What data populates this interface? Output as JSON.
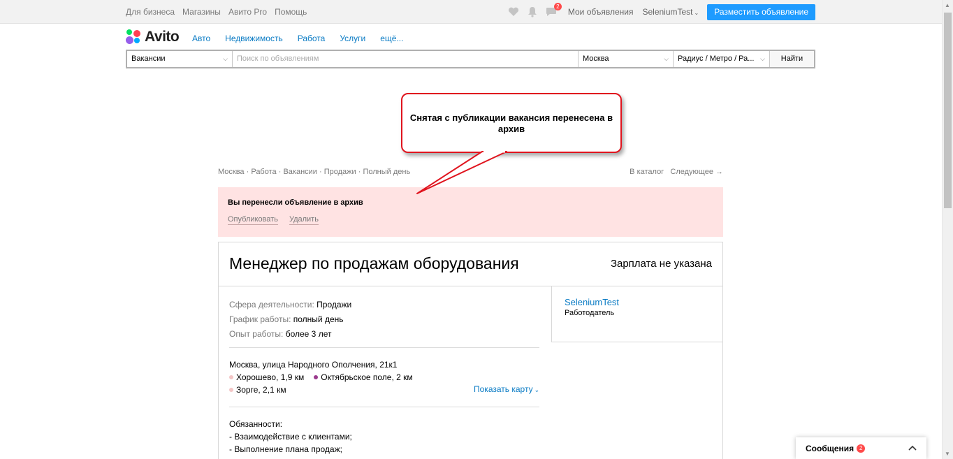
{
  "topbar": {
    "links": [
      "Для бизнеса",
      "Магазины",
      "Авито Pro",
      "Помощь"
    ],
    "messages_badge": "2",
    "my_ads": "Мои объявления",
    "user": "SeleniumTest",
    "post_button": "Разместить объявление"
  },
  "header": {
    "logo": "Avito",
    "nav": [
      "Авто",
      "Недвижимость",
      "Работа",
      "Услуги",
      "ещё..."
    ]
  },
  "search": {
    "category": "Вакансии",
    "placeholder": "Поиск по объявлениям",
    "city": "Москва",
    "radius": "Радиус / Метро / Ра...",
    "find_button": "Найти"
  },
  "callout": {
    "text": "Снятая с публикации вакансия перенесена в архив",
    "border_color": "#e0141e"
  },
  "breadcrumbs": {
    "items": [
      "Москва",
      "Работа",
      "Вакансии",
      "Продажи",
      "Полный день"
    ],
    "catalog": "В каталог",
    "next": "Следующее →"
  },
  "notice": {
    "title": "Вы перенесли объявление в архив",
    "publish": "Опубликовать",
    "delete": "Удалить",
    "bg_color": "#ffe3e3"
  },
  "ad": {
    "title": "Менеджер по продажам оборудования",
    "salary": "Зарплата не указана",
    "params": [
      {
        "key": "Сфера деятельности:",
        "value": "Продажи"
      },
      {
        "key": "График работы:",
        "value": "полный день"
      },
      {
        "key": "Опыт работы:",
        "value": "более 3 лет"
      }
    ],
    "address": "Москва, улица Народного Ополчения, 21к1",
    "metro": [
      {
        "name": "Хорошево, 1,9 км",
        "color": "#f3c6c6"
      },
      {
        "name": "Октябрьское поле, 2 км",
        "color": "#9b3b8e"
      },
      {
        "name": "Зорге, 2,1 км",
        "color": "#f3c6c6"
      }
    ],
    "show_map": "Показать карту",
    "description": [
      "Обязанности:",
      "- Взаимодействие с клиентами;",
      "- Выполнение плана продаж;"
    ]
  },
  "seller": {
    "name": "SeleniumTest",
    "role": "Работодатель"
  },
  "messages_panel": {
    "label": "Сообщения",
    "badge": "2"
  }
}
